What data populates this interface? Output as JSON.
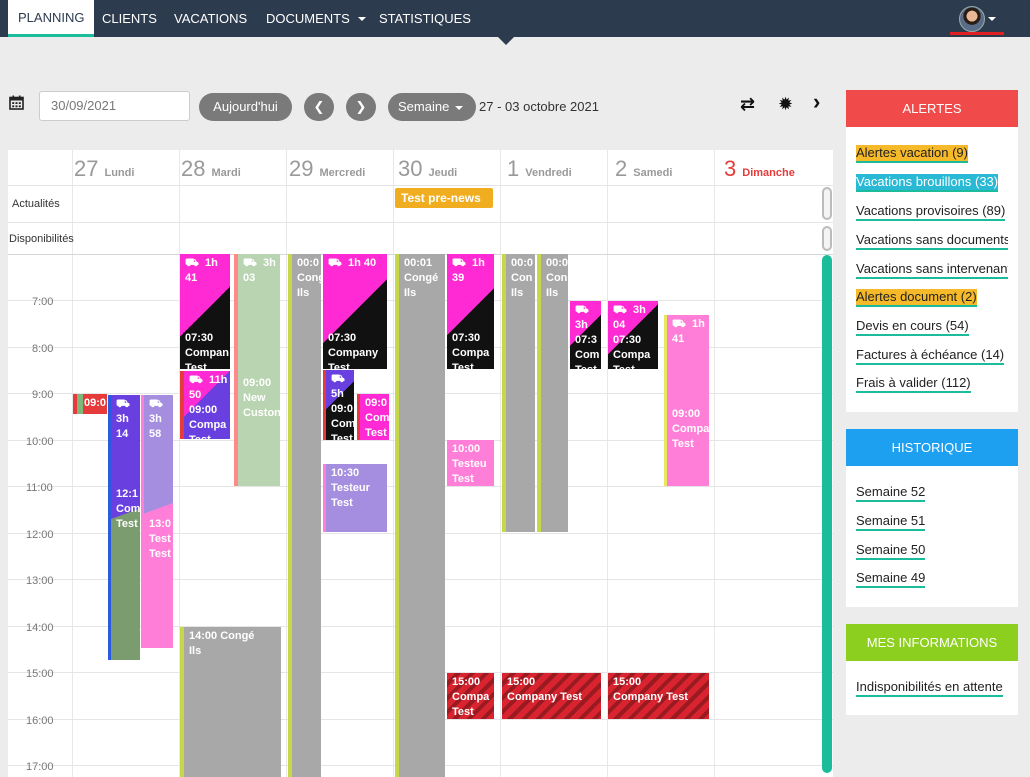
{
  "nav": {
    "tabs": [
      {
        "label": "PLANNING",
        "active": true
      },
      {
        "label": "CLIENTS"
      },
      {
        "label": "VACATIONS"
      },
      {
        "label": "DOCUMENTS",
        "dropdown": true
      },
      {
        "label": "STATISTIQUES"
      }
    ]
  },
  "toolbar": {
    "date": "30/09/2021",
    "today": "Aujourd'hui",
    "prev": "❮",
    "next": "❯",
    "view": "Semaine",
    "week_label": "27 - 03 octobre 2021",
    "swap_icon": "⇄",
    "gear_icon": "✹",
    "chevron_icon": "›"
  },
  "calendar": {
    "days": [
      {
        "num": "27",
        "name": "Lundi"
      },
      {
        "num": "28",
        "name": "Mardi"
      },
      {
        "num": "29",
        "name": "Mercredi"
      },
      {
        "num": "30",
        "name": "Jeudi"
      },
      {
        "num": "1",
        "name": "Vendredi"
      },
      {
        "num": "2",
        "name": "Samedi"
      },
      {
        "num": "3",
        "name": "Dimanche",
        "sunday": true
      }
    ],
    "row_actualites": "Actualités",
    "row_disponibilites": "Disponibilités",
    "news_label": "Test pre-news",
    "hours": [
      "7:00",
      "8:00",
      "9:00",
      "10:00",
      "11:00",
      "12:00",
      "13:00",
      "14:00",
      "15:00",
      "16:00",
      "17:00"
    ],
    "events": [
      {
        "text": "09:0",
        "color": "#e53b3b"
      },
      {
        "text": "⛟\n3h\n14\n\n\n\n12:1\nCom\nTest",
        "color": "#6a3fe0"
      },
      {
        "text": "⛟\n3h\n58\n\n\n\n\n\n13:0\nTest\nTest",
        "color": "#a58de0"
      },
      {
        "text": "⛟  1h\n41\n\n\n\n07:30\nCompan\nTest",
        "color": "#111"
      },
      {
        "text": "⛟  11h\n50\n09:00\nCompa\nTest",
        "color": "#e53b3b"
      },
      {
        "text": "⛟  3h\n03\n\n\n\n\n\n\n09:00\nNew\nCuston",
        "color": "#b8d4b0"
      },
      {
        "text": "14:00 Congé\nIls",
        "color": "#a8a8a8"
      },
      {
        "text": "00:0\nCong\nIls",
        "color": "#a8a8a8"
      },
      {
        "text": "⛟  1h 40\n\n\n\n\n07:30\nCompany\nTest",
        "color": "#111"
      },
      {
        "text": "⛟\n5h\n09:0\nCom\nTest",
        "color": "#6a3fe0"
      },
      {
        "text": "09:0\nCom\nTest",
        "color": "#ff2ad4"
      },
      {
        "text": "10:30\nTesteur\nTest",
        "color": "#a58de0"
      },
      {
        "text": "00:01\nCongé\nIls",
        "color": "#a8a8a8"
      },
      {
        "text": "⛟  1h\n39\n\n\n\n07:30\nCompa\nTest",
        "color": "#111"
      },
      {
        "text": "10:00\nTesteu\nTest",
        "color": "#ff7fd8"
      },
      {
        "text": "15:00\nCompa\nTest",
        "color": "#d9242f"
      },
      {
        "text": "00:0\nCon\nIls",
        "color": "#a8a8a8"
      },
      {
        "text": "00:0\nCon\nIls",
        "color": "#a8a8a8"
      },
      {
        "text": "15:00\nCompany Test",
        "color": "#d9242f"
      },
      {
        "text": "⛟\n3h\n07:3\nCom\nTest",
        "color": "#111"
      },
      {
        "text": "⛟  3h\n04\n07:30\nCompa\nTest",
        "color": "#111"
      },
      {
        "text": "15:00\nCompany Test",
        "color": "#d9242f"
      },
      {
        "text": "⛟  1h\n41\n\n\n\n\n09:00\nCompa\nTest",
        "color": "#ff7fd8"
      }
    ]
  },
  "alertes": {
    "title": "ALERTES",
    "color": "#f04a4a",
    "items": [
      {
        "label": "Alertes vacation (9)",
        "style": "orange"
      },
      {
        "label": "Vacations brouillons (33)",
        "style": "cyan"
      },
      {
        "label": "Vacations provisoires (89)"
      },
      {
        "label": "Vacations sans documents"
      },
      {
        "label": "Vacations sans intervenant"
      },
      {
        "label": "Alertes document (2)",
        "style": "orange"
      },
      {
        "label": "Devis en cours (54)"
      },
      {
        "label": "Factures à échéance (14)"
      },
      {
        "label": "Frais à valider (112)"
      }
    ]
  },
  "historique": {
    "title": "HISTORIQUE",
    "color": "#1ea0f0",
    "items": [
      {
        "label": "Semaine 52"
      },
      {
        "label": "Semaine 51"
      },
      {
        "label": "Semaine 50"
      },
      {
        "label": "Semaine 49"
      }
    ]
  },
  "infos": {
    "title": "MES INFORMATIONS",
    "color": "#8ccf1e",
    "items": [
      {
        "label": "Indisponibilités en attente"
      }
    ]
  }
}
